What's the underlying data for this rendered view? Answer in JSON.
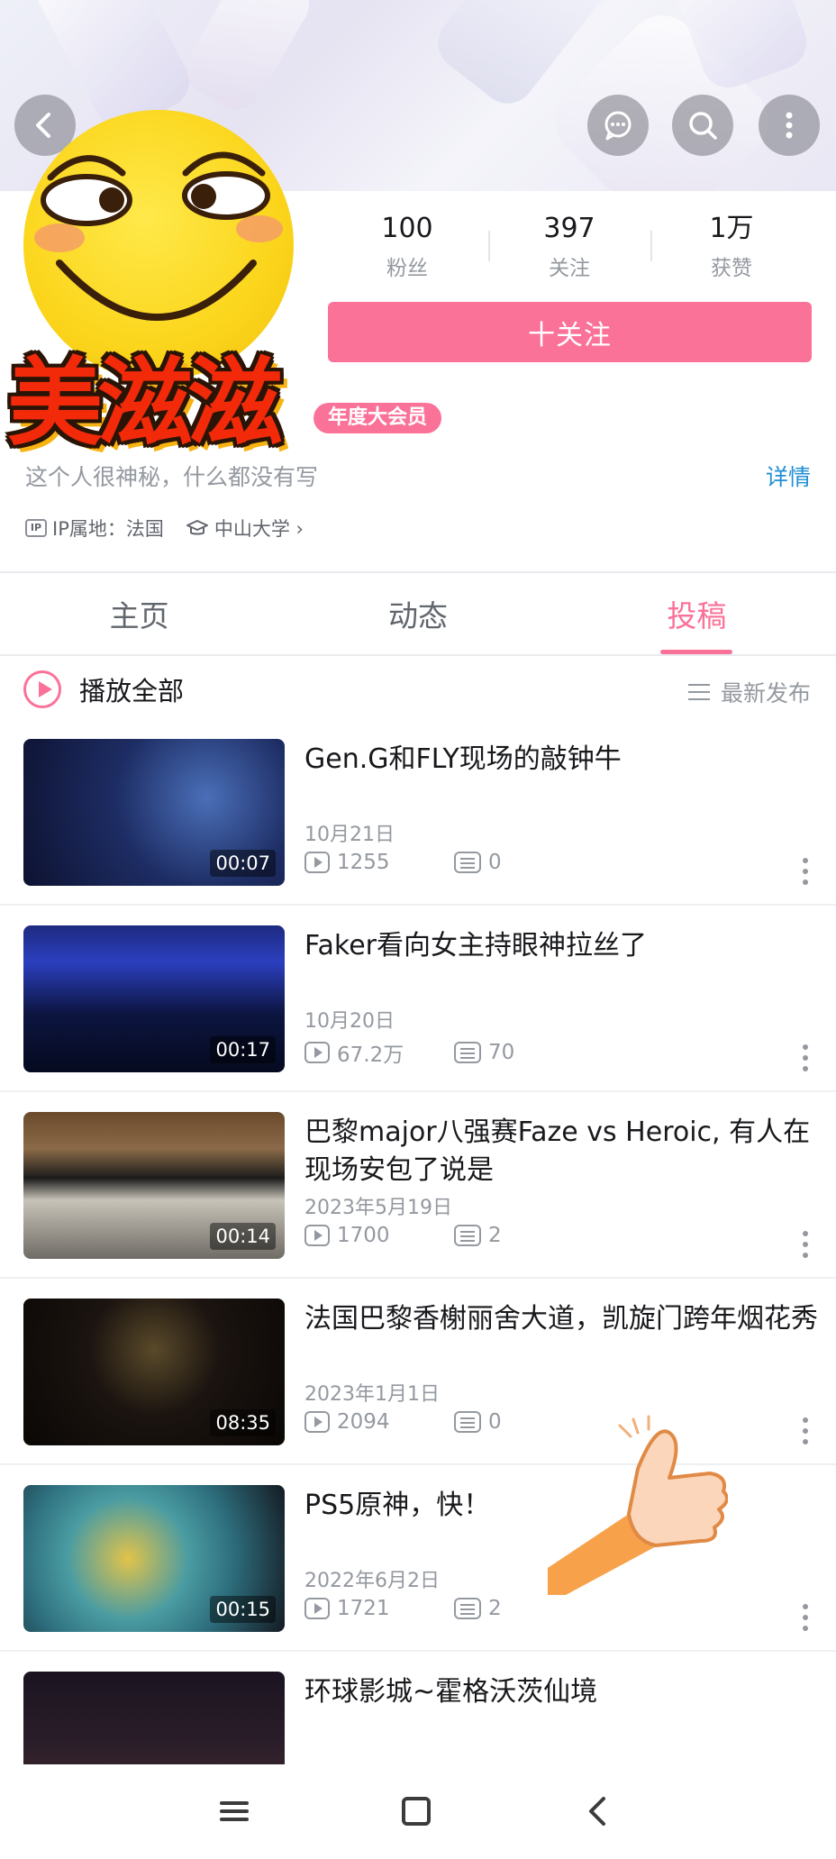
{
  "header": {
    "back_icon": "chevron-left-icon",
    "message_icon": "message-icon",
    "search_icon": "search-icon",
    "more_icon": "more-vertical-icon"
  },
  "profile": {
    "sticker_text": "美滋滋",
    "vip_badge": "年度大会员",
    "bio": "这个人很神秘，什么都没有写",
    "details_link": "详情",
    "ip_badge": "IP",
    "ip_location": "IP属地：法国",
    "school": "中山大学 ›",
    "follow_button": "十关注",
    "stats": [
      {
        "value": "100",
        "label": "粉丝"
      },
      {
        "value": "397",
        "label": "关注"
      },
      {
        "value": "1万",
        "label": "获赞"
      }
    ]
  },
  "tabs": [
    {
      "label": "主页",
      "active": false
    },
    {
      "label": "动态",
      "active": false
    },
    {
      "label": "投稿",
      "active": true
    }
  ],
  "list_header": {
    "play_all": "播放全部",
    "sort": "最新发布"
  },
  "videos": [
    {
      "title": "Gen.G和FLY现场的敲钟牛",
      "duration": "00:07",
      "date": "10月21日",
      "views": "1255",
      "danmaku": "0"
    },
    {
      "title": "Faker看向女主持眼神拉丝了",
      "duration": "00:17",
      "date": "10月20日",
      "views": "67.2万",
      "danmaku": "70"
    },
    {
      "title": "巴黎major八强赛Faze vs Heroic, 有人在现场安包了说是",
      "duration": "00:14",
      "date": "2023年5月19日",
      "views": "1700",
      "danmaku": "2"
    },
    {
      "title": "法国巴黎香榭丽舍大道，凯旋门跨年烟花秀",
      "duration": "08:35",
      "date": "2023年1月1日",
      "views": "2094",
      "danmaku": "0"
    },
    {
      "title": "PS5原神，快！",
      "duration": "00:15",
      "date": "2022年6月2日",
      "views": "1721",
      "danmaku": "2"
    },
    {
      "title": "环球影城~霍格沃茨仙境",
      "duration": "",
      "date": "",
      "views": "",
      "danmaku": ""
    }
  ],
  "colors": {
    "accent": "#fb7299",
    "link": "#1f8fd5",
    "muted": "#9499a0"
  }
}
